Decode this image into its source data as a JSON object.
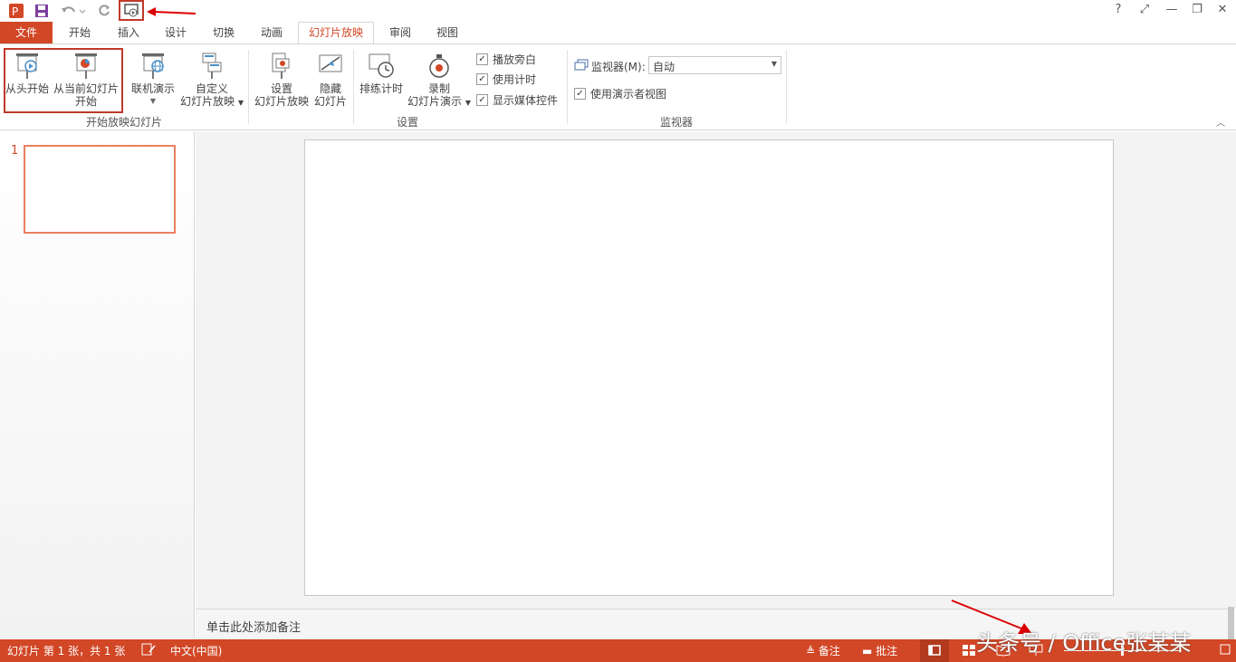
{
  "quick_access": {
    "app_icon": "powerpoint-icon",
    "save_icon": "save-icon",
    "undo_icon": "undo-icon",
    "redo_icon": "redo-icon",
    "slideshow_icon": "slideshow-from-start-icon"
  },
  "window_controls": [
    "?",
    "⤢",
    "—",
    "❐",
    "✕"
  ],
  "tabs": [
    "文件",
    "开始",
    "插入",
    "设计",
    "切换",
    "动画",
    "幻灯片放映",
    "审阅",
    "视图"
  ],
  "ribbon": {
    "group_start": {
      "label": "开始放映幻灯片",
      "from_beginning": "从头开始",
      "from_current_line1": "从当前幻灯片",
      "from_current_line2": "开始",
      "online": "联机演示",
      "custom_line1": "自定义",
      "custom_line2": "幻灯片放映"
    },
    "group_setup": {
      "label": "设置",
      "setup_line1": "设置",
      "setup_line2": "幻灯片放映",
      "hide_line1": "隐藏",
      "hide_line2": "幻灯片",
      "rehearse": "排练计时",
      "record_line1": "录制",
      "record_line2": "幻灯片演示",
      "play_narrations": "播放旁白",
      "use_timings": "使用计时",
      "show_media_controls": "显示媒体控件"
    },
    "group_monitor": {
      "label": "监视器",
      "monitor_label": "监视器(M):",
      "monitor_value": "自动",
      "presenter_view": "使用演示者视图"
    }
  },
  "thumbnails": [
    {
      "number": "1"
    }
  ],
  "notes_placeholder": "单击此处添加备注",
  "status": {
    "slide_info": "幻灯片 第 1 张，共 1 张",
    "language": "中文(中国)",
    "notes": "备注",
    "comments": "批注"
  },
  "watermark": "头条号 / Office张某某",
  "colors": {
    "accent": "#D24726",
    "annotation_red": "#C0392B"
  }
}
